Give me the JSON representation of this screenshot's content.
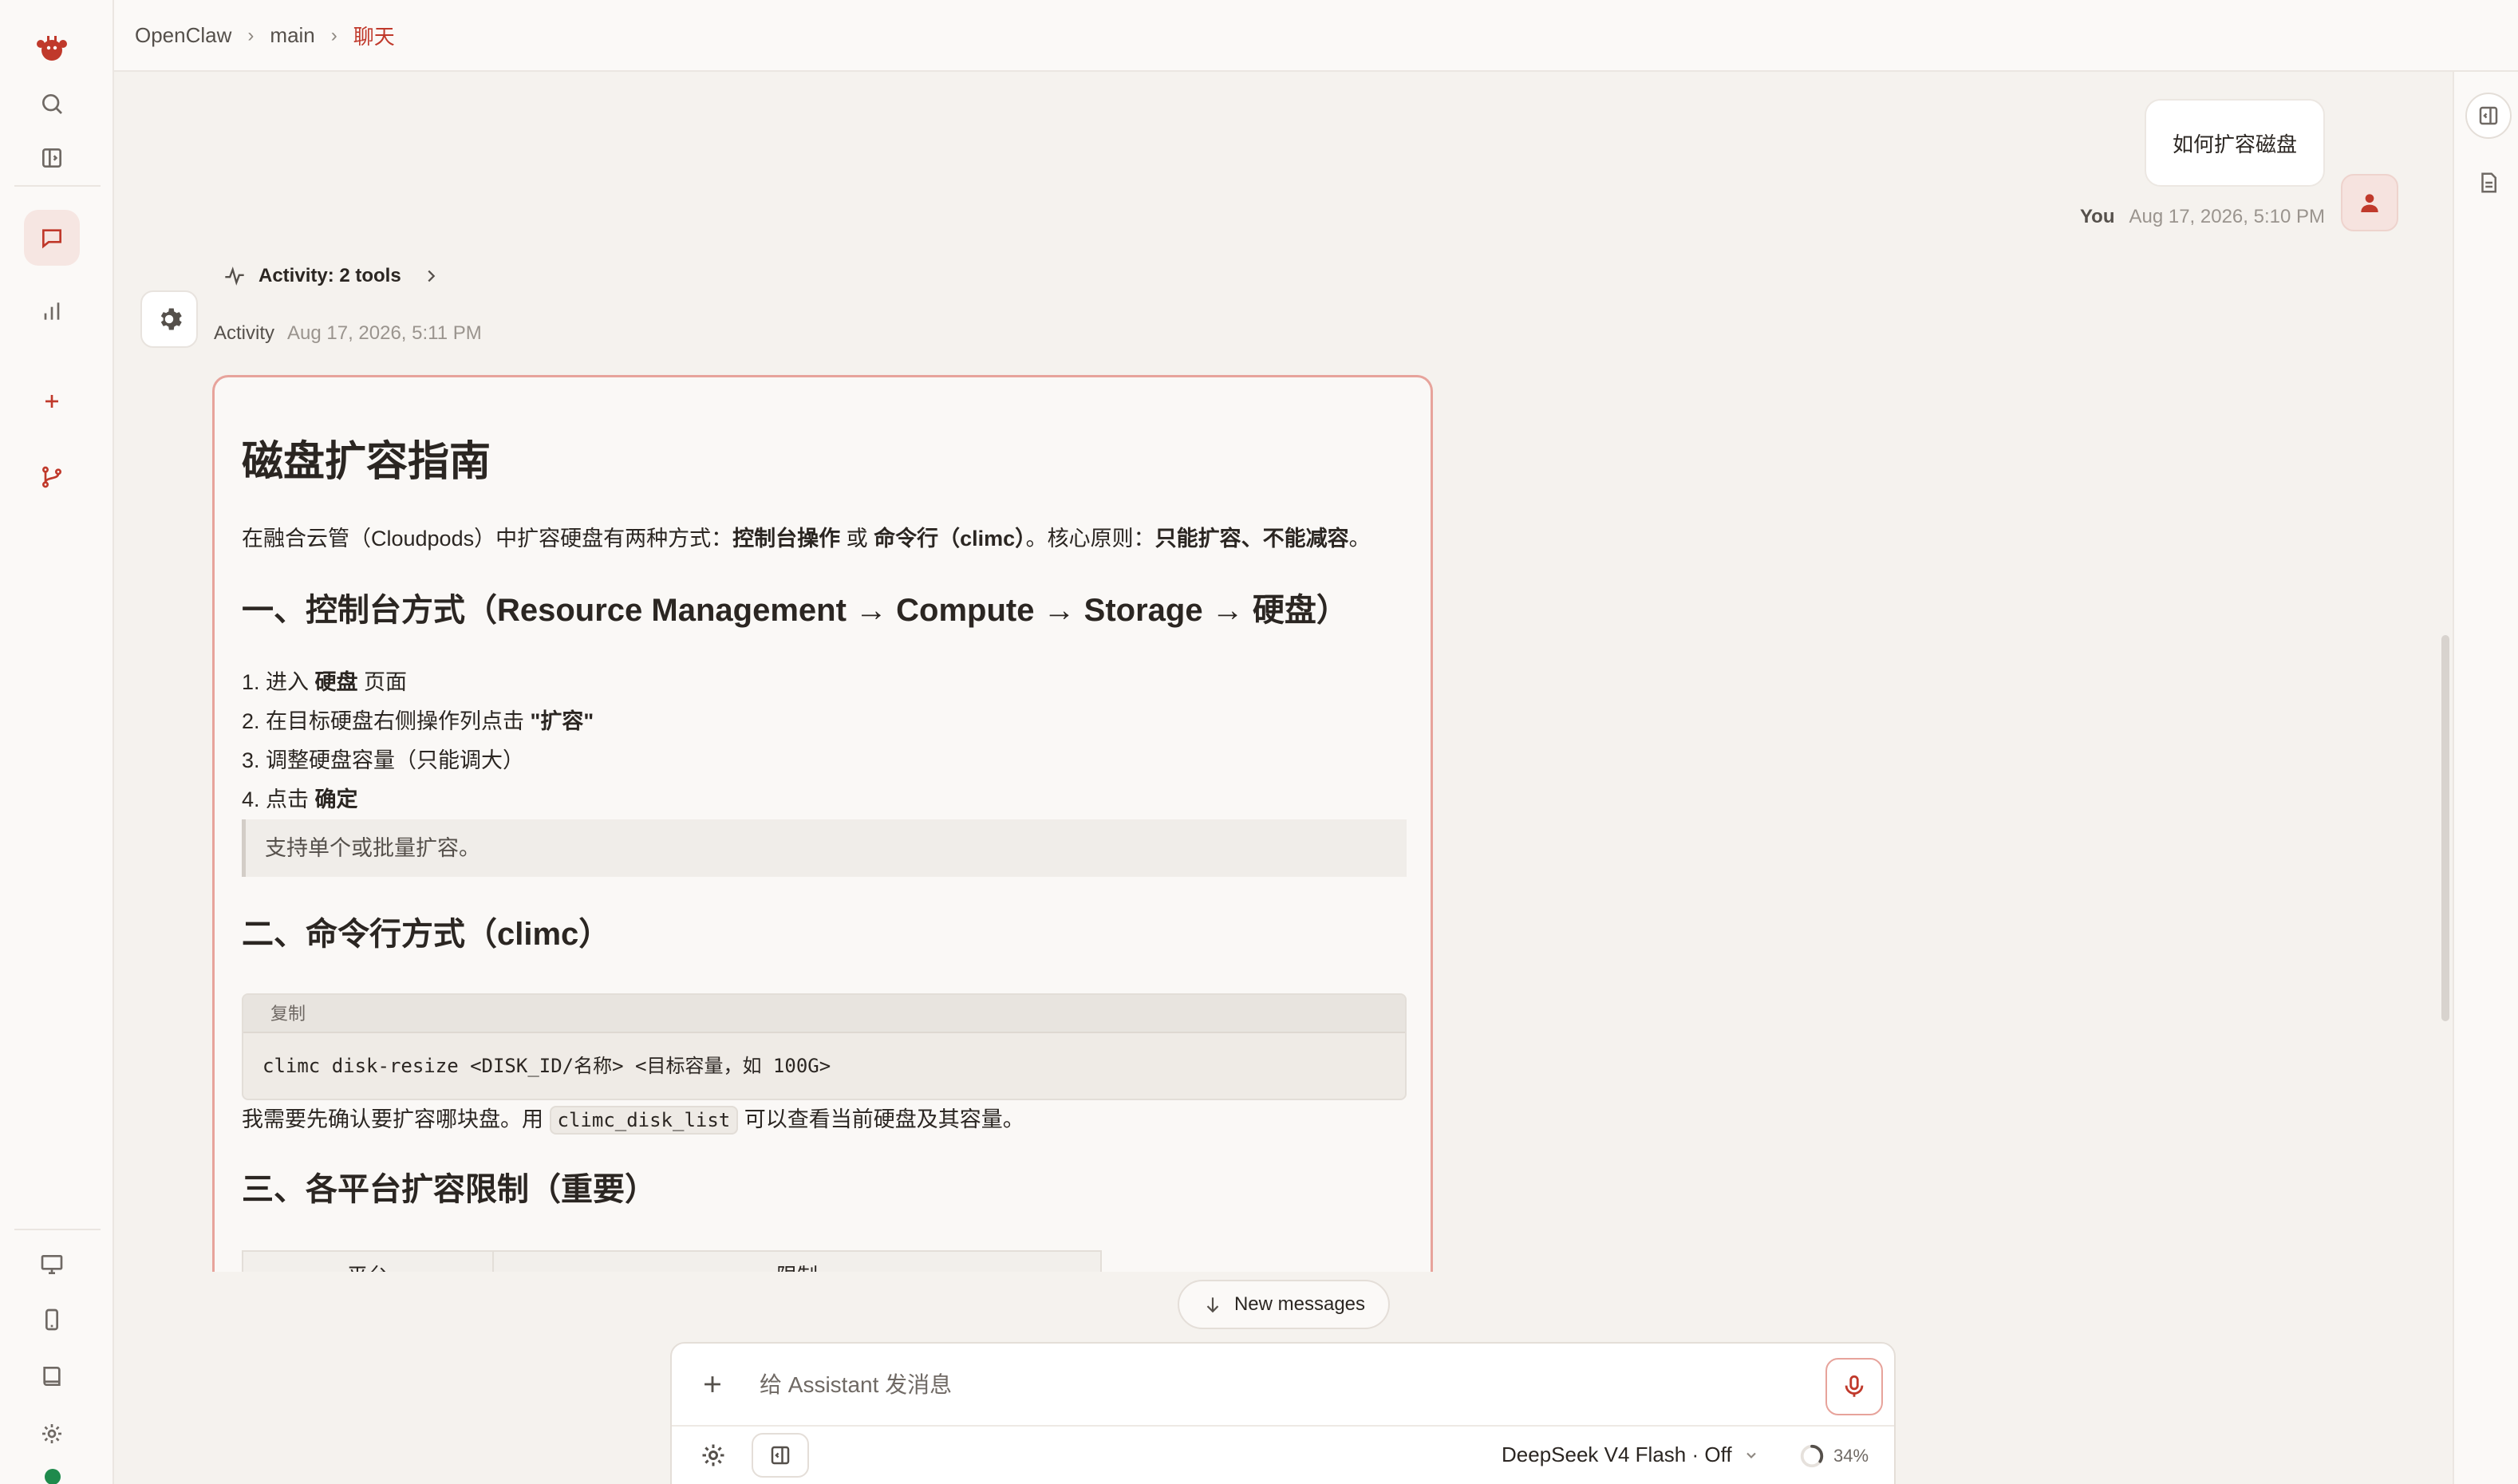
{
  "breadcrumb": {
    "root": "OpenClaw",
    "branch": "main",
    "current": "聊天"
  },
  "user_message": {
    "text": "如何扩容磁盘",
    "author": "You",
    "time": "Aug 17, 2026, 5:10 PM"
  },
  "activity": {
    "toggle_label": "Activity: 2 tools",
    "author": "Activity",
    "time": "Aug 17, 2026, 5:11 PM"
  },
  "answer": {
    "title": "磁盘扩容指南",
    "intro": {
      "part1": "在融合云管（Cloudpods）中扩容硬盘有两种方式：",
      "bold1": "控制台操作",
      "part2": " 或 ",
      "bold2": "命令行（climc）",
      "part3": "。核心原则：",
      "bold3": "只能扩容、不能减容",
      "part4": "。"
    },
    "section1": {
      "heading": "一、控制台方式（Resource Management → Compute → Storage → 硬盘）",
      "steps": [
        {
          "pre": "1. 进入 ",
          "bold": "硬盘",
          "post": " 页面"
        },
        {
          "pre": "2. 在目标硬盘右侧操作列点击 ",
          "bold": "\"扩容\"",
          "post": ""
        },
        {
          "pre": "3. 调整硬盘容量（只能调大）",
          "bold": "",
          "post": ""
        },
        {
          "pre": "4. 点击 ",
          "bold": "确定",
          "post": ""
        }
      ],
      "note": "支持单个或批量扩容。"
    },
    "section2": {
      "heading": "二、命令行方式（climc）",
      "copy_label": "复制",
      "code": "climc disk-resize <DISK_ID/名称> <目标容量，如 100G>",
      "after_pre": "我需要先确认要扩容哪块盘。用 ",
      "after_code": "climc_disk_list",
      "after_post": " 可以查看当前硬盘及其容量。"
    },
    "section3": {
      "heading": "三、各平台扩容限制（重要）",
      "table_headers": [
        "平台",
        "限制"
      ]
    }
  },
  "new_messages_label": "New messages",
  "composer": {
    "placeholder": "给 Assistant 发消息",
    "model_label": "DeepSeek V4 Flash · Off",
    "usage_percent": "34%",
    "usage_value": 0.34
  },
  "colors": {
    "accent": "#c0392b",
    "background": "#f5f2ee",
    "card_border": "#e7a39b"
  }
}
